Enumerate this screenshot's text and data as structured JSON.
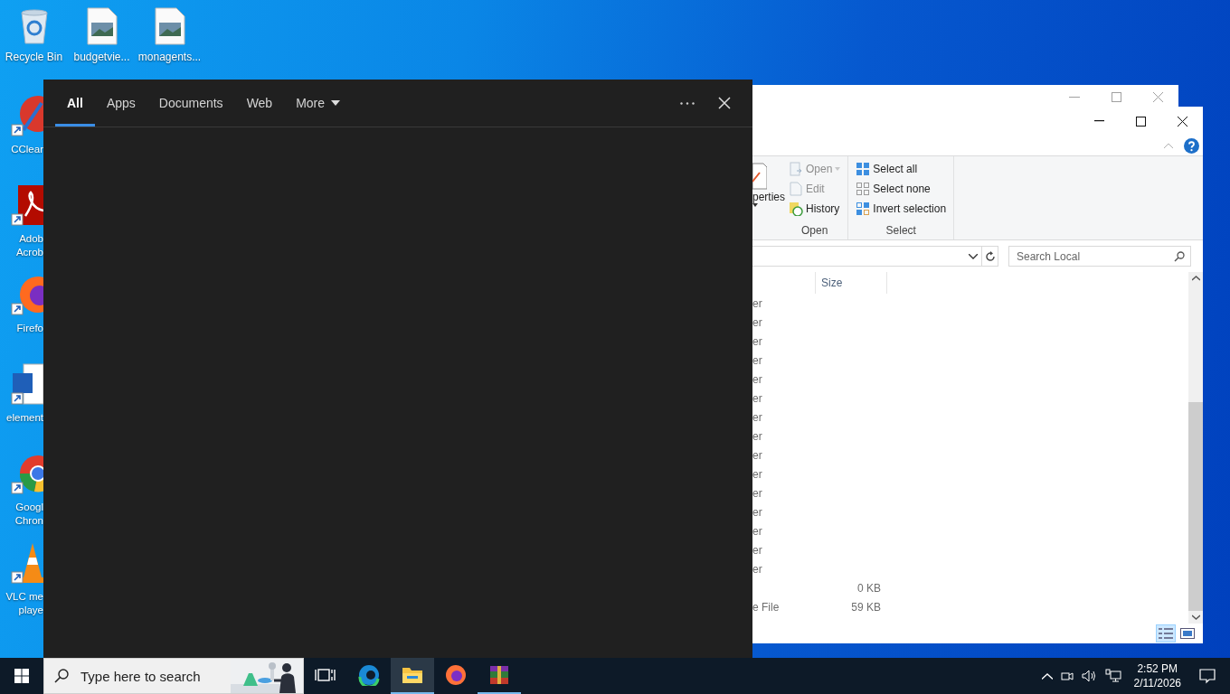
{
  "desktop_top_icons": [
    {
      "label": "Recycle Bin",
      "kind": "recycle"
    },
    {
      "label": "budgetvie...",
      "kind": "image_file"
    },
    {
      "label": "monagents...",
      "kind": "image_file"
    }
  ],
  "desktop_side_icons": [
    {
      "label": "CClear",
      "kind": "cleaner"
    },
    {
      "label": "Adob\nAcrob",
      "kind": "pdf"
    },
    {
      "label": "Firefo",
      "kind": "firefox"
    },
    {
      "label": "element",
      "kind": "word"
    },
    {
      "label": "Googl\nChron",
      "kind": "chrome"
    },
    {
      "label": "VLC me\nplaye",
      "kind": "vlc"
    }
  ],
  "explorer": {
    "ribbon": {
      "partial_button": "perties",
      "groups": [
        {
          "label": "Open",
          "items": [
            {
              "label": "Open",
              "kind": "open",
              "disabled": true
            },
            {
              "label": "Edit",
              "kind": "edit",
              "disabled": true
            },
            {
              "label": "History",
              "kind": "history",
              "disabled": false
            }
          ]
        },
        {
          "label": "Select",
          "items": [
            {
              "label": "Select all",
              "kind": "select_all",
              "disabled": false
            },
            {
              "label": "Select none",
              "kind": "select_none",
              "disabled": false
            },
            {
              "label": "Invert selection",
              "kind": "invert",
              "disabled": false
            }
          ]
        }
      ]
    },
    "search": {
      "placeholder": "Search Local"
    },
    "columns": [
      "Size"
    ],
    "rows": [
      {
        "column_1": "er"
      },
      {
        "column_1": "er"
      },
      {
        "column_1": "er"
      },
      {
        "column_1": "er"
      },
      {
        "column_1": "er"
      },
      {
        "column_1": "er"
      },
      {
        "column_1": "er"
      },
      {
        "column_1": "er"
      },
      {
        "column_1": "er"
      },
      {
        "column_1": "er"
      },
      {
        "column_1": "er"
      },
      {
        "column_1": "er"
      },
      {
        "column_1": "er"
      },
      {
        "column_1": "er"
      },
      {
        "column_1": "er"
      },
      {
        "size": "0 KB"
      },
      {
        "column_1": "e File",
        "size": "59 KB"
      }
    ]
  },
  "search_panel": {
    "tabs": [
      {
        "label": "All",
        "selected": true,
        "dropdown": false
      },
      {
        "label": "Apps",
        "selected": false,
        "dropdown": false
      },
      {
        "label": "Documents",
        "selected": false,
        "dropdown": false
      },
      {
        "label": "Web",
        "selected": false,
        "dropdown": false
      },
      {
        "label": "More",
        "selected": false,
        "dropdown": true
      }
    ]
  },
  "taskbar": {
    "search": {
      "placeholder": "Type here to search"
    },
    "apps": [
      {
        "kind": "task_view",
        "active": false,
        "running": false
      },
      {
        "kind": "edge",
        "active": false,
        "running": false
      },
      {
        "kind": "explorer",
        "active": true,
        "running": true
      },
      {
        "kind": "firefox",
        "active": false,
        "running": false
      },
      {
        "kind": "winrar",
        "active": false,
        "running": true
      }
    ],
    "time": "2:52 PM",
    "date": "2/11/2026"
  }
}
